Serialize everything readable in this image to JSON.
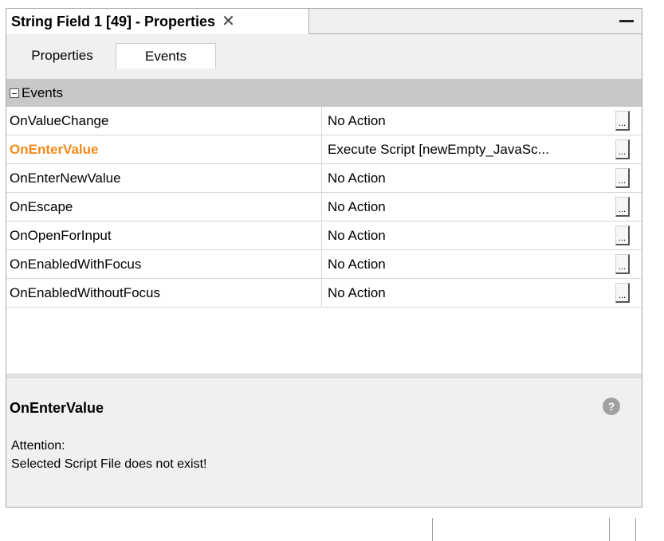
{
  "window": {
    "title": "String Field 1 [49] - Properties",
    "close_symbol": "✕",
    "minimize_icon": "minimize-icon"
  },
  "tabs": [
    {
      "label": "Properties",
      "active": false
    },
    {
      "label": "Events",
      "active": true
    }
  ],
  "grid": {
    "category": "Events",
    "rows": [
      {
        "name": "OnValueChange",
        "value": "No Action",
        "selected": false
      },
      {
        "name": "OnEnterValue",
        "value": "Execute Script [newEmpty_JavaSc...",
        "selected": true
      },
      {
        "name": "OnEnterNewValue",
        "value": "No Action",
        "selected": false
      },
      {
        "name": "OnEscape",
        "value": "No Action",
        "selected": false
      },
      {
        "name": "OnOpenForInput",
        "value": "No Action",
        "selected": false
      },
      {
        "name": "OnEnabledWithFocus",
        "value": "No Action",
        "selected": false
      },
      {
        "name": "OnEnabledWithoutFocus",
        "value": "No Action",
        "selected": false
      }
    ],
    "ellipsis_label": "..."
  },
  "description": {
    "title": "OnEnterValue",
    "line1": "Attention:",
    "line2": "Selected Script File does not exist!",
    "help_symbol": "?"
  },
  "colors": {
    "selected_text": "#f28a1a",
    "category_bg": "#c8c8c8",
    "panel_bg": "#f0f0f0"
  }
}
